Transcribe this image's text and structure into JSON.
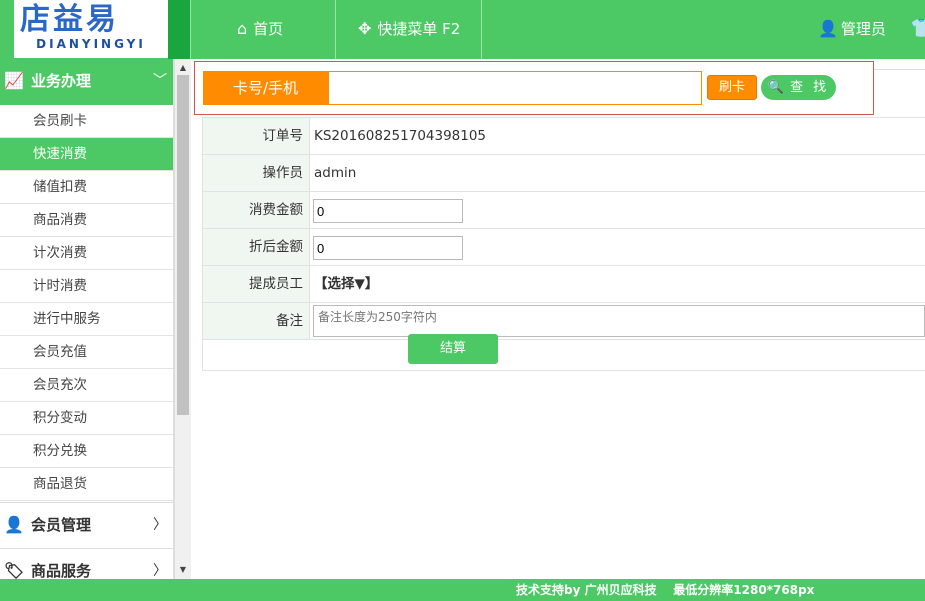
{
  "logo": {
    "cn": "店益易",
    "en": "DIANYINGYI"
  },
  "nav": {
    "home": "首页",
    "quick_menu": "快捷菜单 F2",
    "admin": "管理员"
  },
  "sidebar": {
    "sections": [
      {
        "label": "业务办理",
        "expanded": true
      },
      {
        "label": "会员管理",
        "expanded": false
      },
      {
        "label": "商品服务",
        "expanded": false
      }
    ],
    "items": [
      "会员刷卡",
      "快速消费",
      "储值扣费",
      "商品消费",
      "计次消费",
      "计时消费",
      "进行中服务",
      "会员充值",
      "会员充次",
      "积分变动",
      "积分兑换",
      "商品退货"
    ],
    "active_item": "快速消费"
  },
  "search": {
    "label": "卡号/手机",
    "value": "",
    "swipe_button": "刷卡",
    "search_button": "查 找"
  },
  "form": {
    "order_no_label": "订单号",
    "order_no": "KS201608251704398105",
    "operator_label": "操作员",
    "operator": "admin",
    "amount_label": "消费金额",
    "amount": "0",
    "discount_label": "折后金额",
    "discount": "0",
    "staff_label": "提成员工",
    "staff_select": "【选择▼】",
    "remark_label": "备注",
    "remark_placeholder": "备注长度为250字符内",
    "settle_button": "结算"
  },
  "footer": {
    "text": "技术支持by 广州贝应科技    最低分辨率1280*768px"
  },
  "colors": {
    "brand_green": "#4cc964",
    "accent_orange": "#ff8c00",
    "logo_blue": "#2a67c7"
  }
}
